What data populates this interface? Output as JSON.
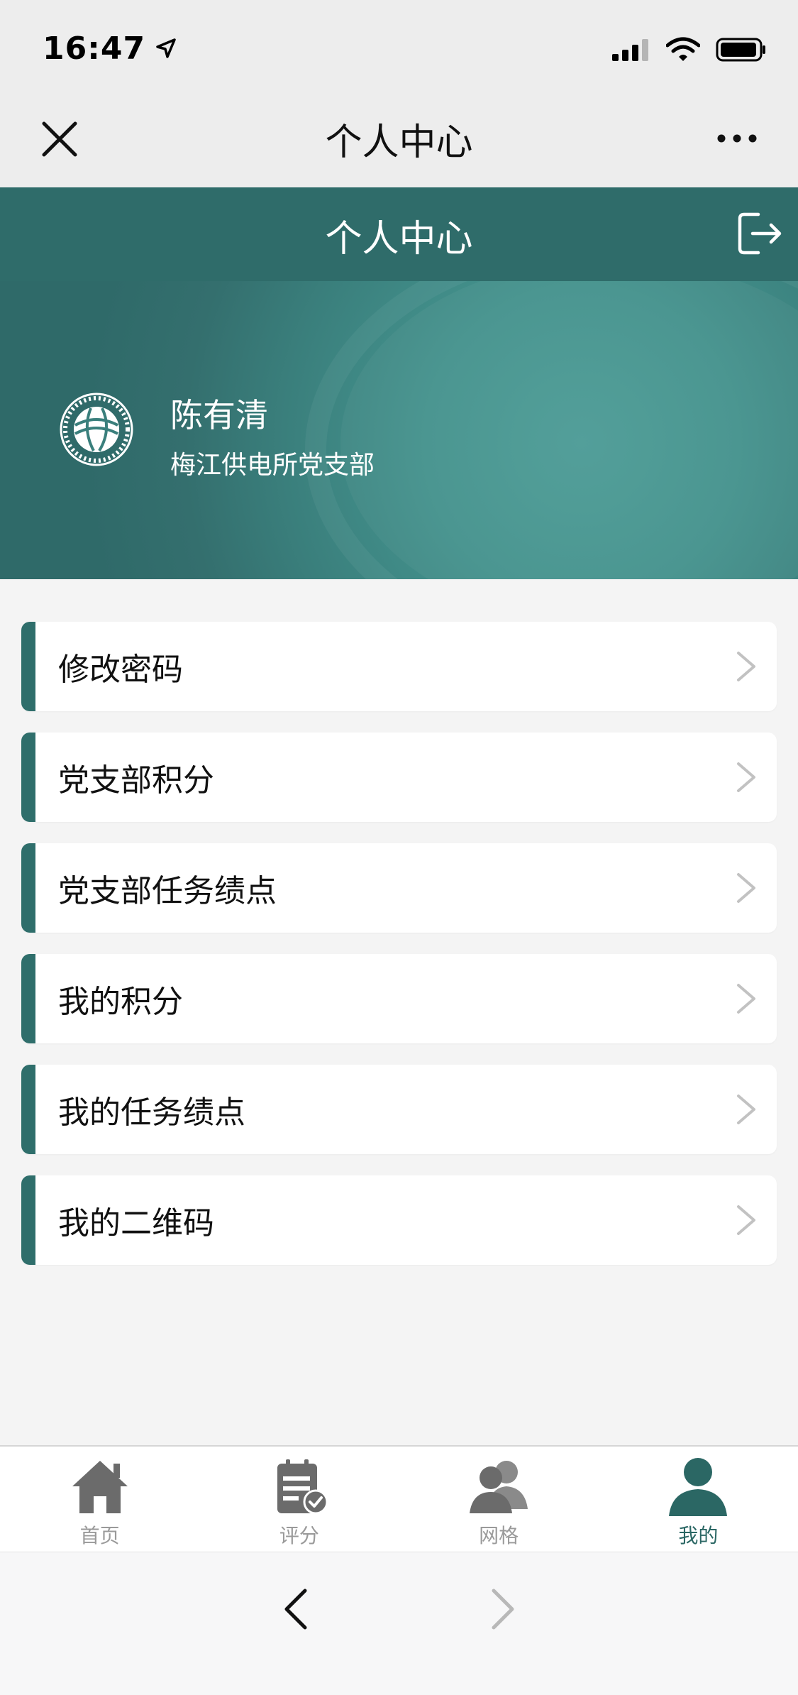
{
  "status_bar": {
    "time": "16:47"
  },
  "nav": {
    "title": "个人中心"
  },
  "banner": {
    "title": "个人中心"
  },
  "user": {
    "name": "陈有清",
    "dept": "梅江供电所党支部"
  },
  "menu": {
    "items": [
      {
        "label": "修改密码"
      },
      {
        "label": "党支部积分"
      },
      {
        "label": "党支部任务绩点"
      },
      {
        "label": "我的积分"
      },
      {
        "label": "我的任务绩点"
      },
      {
        "label": "我的二维码"
      }
    ]
  },
  "tabbar": {
    "tabs": [
      {
        "label": "首页",
        "icon": "home-icon"
      },
      {
        "label": "评分",
        "icon": "clipboard-check-icon"
      },
      {
        "label": "网格",
        "icon": "users-icon"
      },
      {
        "label": "我的",
        "icon": "user-icon",
        "active": true
      }
    ]
  },
  "colors": {
    "accent": "#2f6e6b",
    "active_tab": "#2b6764",
    "inactive_tab": "#9a9a9a"
  }
}
